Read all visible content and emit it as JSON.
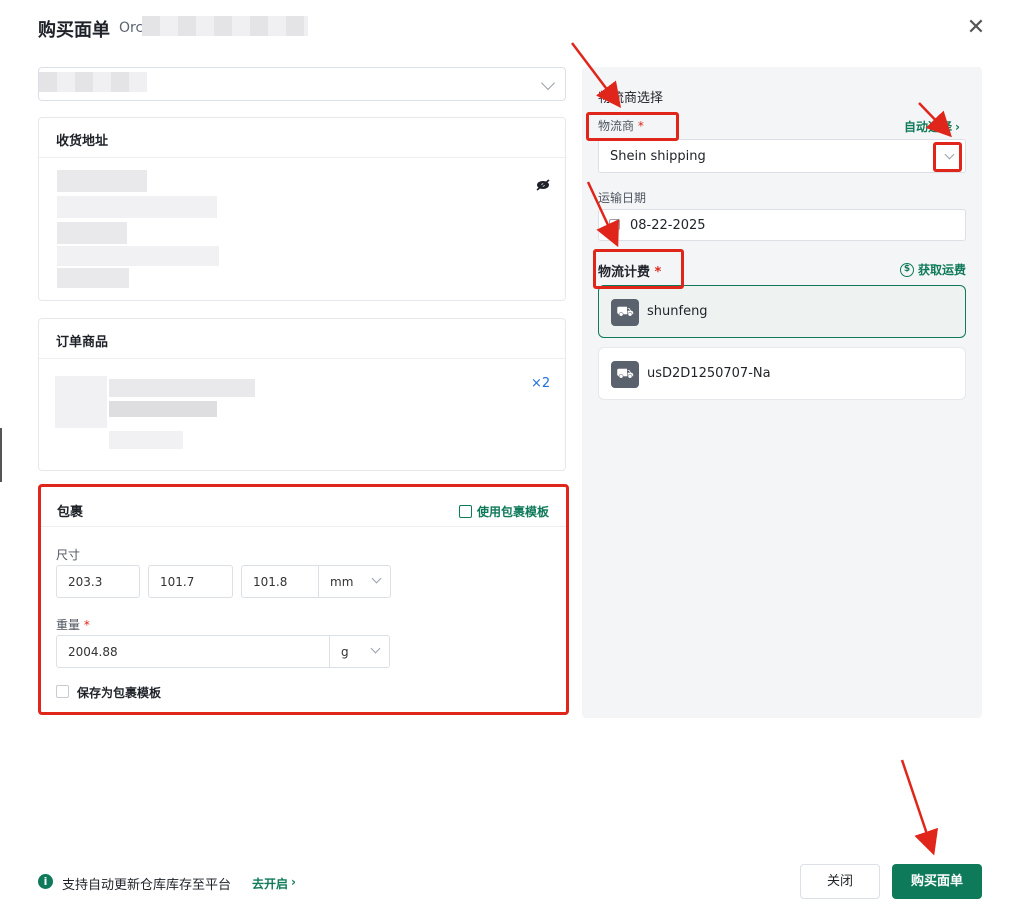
{
  "header": {
    "title": "购买面单",
    "order_prefix": "Orc",
    "close_icon": "close-icon"
  },
  "sections": {
    "address_title": "收货地址",
    "items_title": "订单商品",
    "item_quantity": "×2"
  },
  "package": {
    "title": "包裹",
    "template_link": "使用包裹模板",
    "size_label": "尺寸",
    "length": "203.3",
    "width": "101.7",
    "height": "101.8",
    "size_unit": "mm",
    "weight_label": "重量",
    "weight": "2004.88",
    "weight_unit": "g",
    "save_template_label": "保存为包裹模板"
  },
  "logistics": {
    "section_title": "物流商选择",
    "carrier_label": "物流商",
    "auto_select_link": "自动选择",
    "carrier_value": "Shein shipping",
    "date_label": "运输日期",
    "date_value": "08-22-2025",
    "fee_label": "物流计费",
    "get_fee_link": "获取运费",
    "options": [
      {
        "name": "shunfeng",
        "selected": true
      },
      {
        "name": "usD2D1250707-Na",
        "selected": false
      }
    ]
  },
  "footer": {
    "info_text": "支持自动更新仓库库存至平台",
    "enable_link": "去开启",
    "close_button": "关闭",
    "buy_button": "购买面单"
  },
  "colors": {
    "accent": "#0f7a5a",
    "highlight": "#e0261b",
    "link_blue": "#1e6fd9"
  }
}
